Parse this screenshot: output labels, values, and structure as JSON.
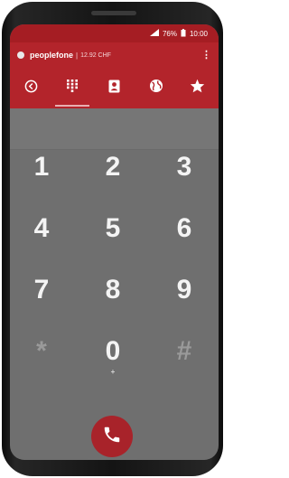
{
  "status_bar": {
    "battery": "76%",
    "time": "10:00"
  },
  "app_bar": {
    "brand": "peoplefone",
    "separator": "|",
    "credit": "12.92 CHF",
    "menu_glyph": "⋮"
  },
  "tabs": [
    {
      "name": "tab-back",
      "icon": "back-circle-icon"
    },
    {
      "name": "tab-dialpad",
      "icon": "dialpad-icon",
      "active": true
    },
    {
      "name": "tab-contacts",
      "icon": "contacts-icon"
    },
    {
      "name": "tab-web",
      "icon": "globe-icon"
    },
    {
      "name": "tab-favorites",
      "icon": "star-icon"
    }
  ],
  "keypad": {
    "k1": "1",
    "k2": "2",
    "k3": "3",
    "k4": "4",
    "k5": "5",
    "k6": "6",
    "k7": "7",
    "k8": "8",
    "k9": "9",
    "star": "*",
    "k0": "0",
    "hash": "#",
    "zero_sub": "+"
  },
  "colors": {
    "accent": "#b3242b",
    "status": "#a51d23",
    "keypad_bg": "#6f6f6f"
  }
}
